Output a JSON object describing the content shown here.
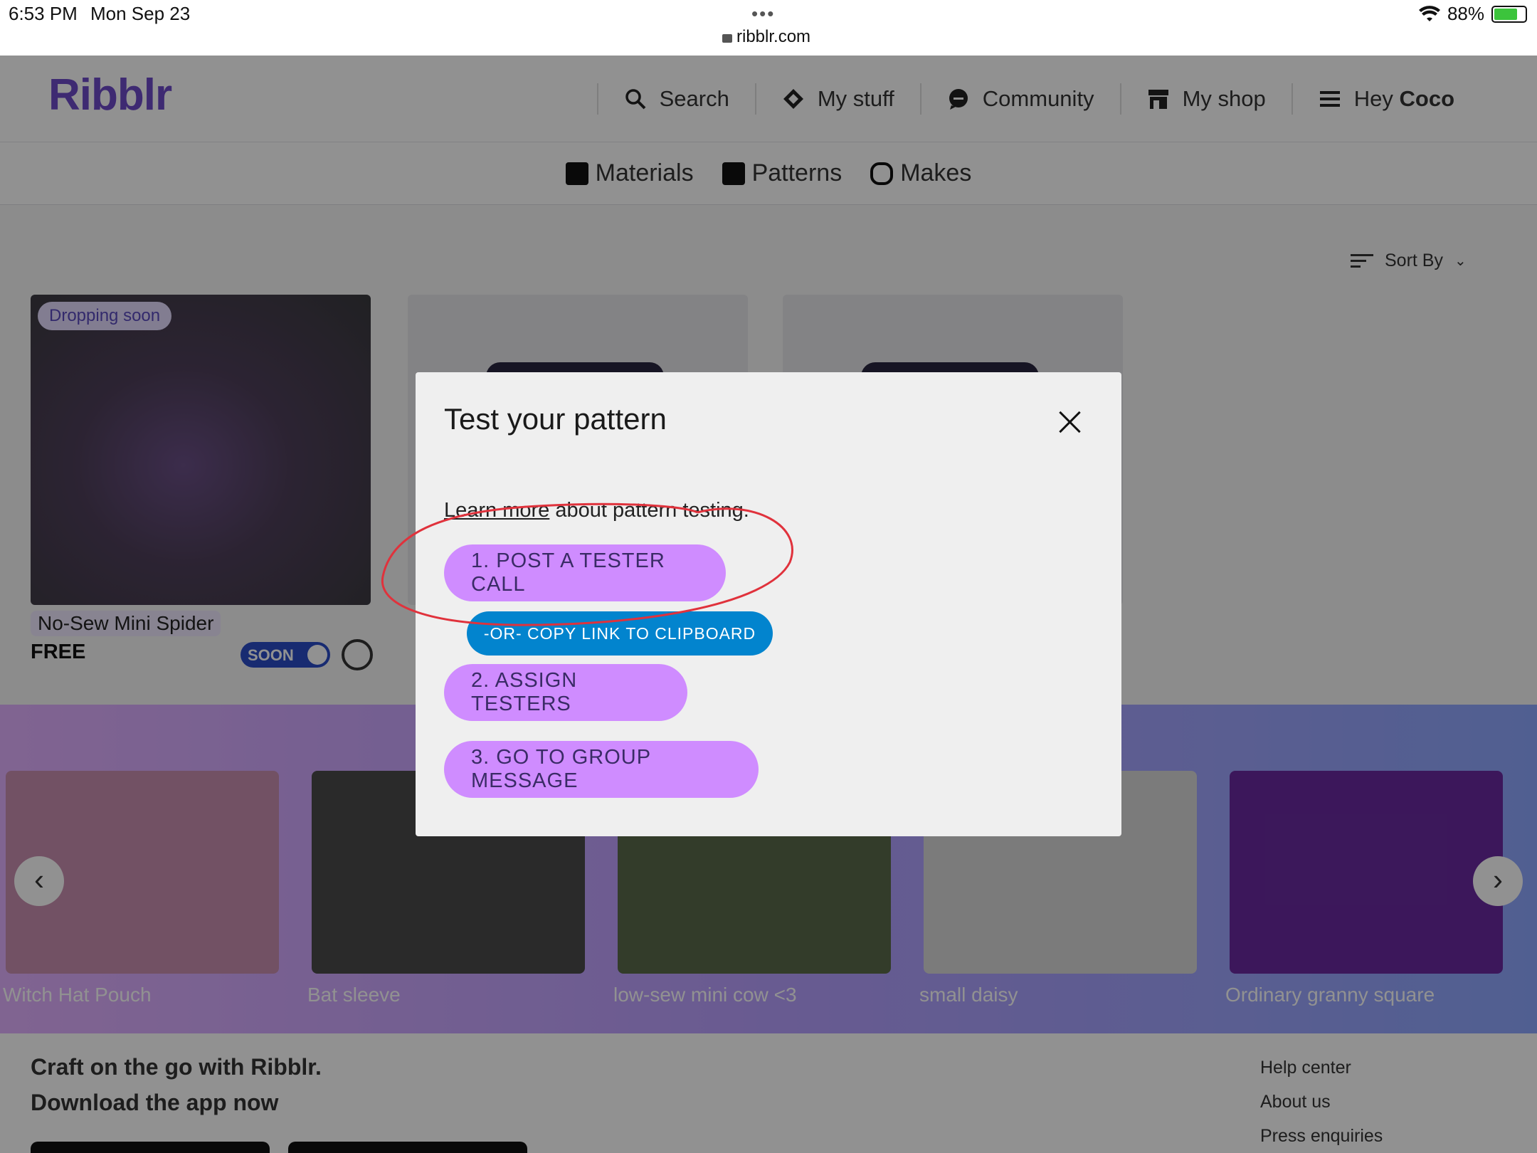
{
  "status": {
    "time": "6:53 PM",
    "date": "Mon Sep 23",
    "dots": "•••",
    "url": "ribblr.com",
    "battery": "88%"
  },
  "header": {
    "logo": "Ribblr",
    "nav": [
      {
        "label": "Search",
        "icon": "search-icon"
      },
      {
        "label": "My stuff",
        "icon": "diamond-icon"
      },
      {
        "label": "Community",
        "icon": "chat-icon"
      },
      {
        "label": "My shop",
        "icon": "shop-icon"
      }
    ],
    "greeting_prefix": "Hey",
    "greeting_name": "Coco"
  },
  "subnav": [
    {
      "label": "Materials",
      "icon": "bag-icon"
    },
    {
      "label": "Patterns",
      "icon": "book-icon"
    },
    {
      "label": "Makes",
      "icon": "yarn-icon"
    }
  ],
  "sort": {
    "label": "Sort By"
  },
  "card": {
    "badge": "Dropping soon",
    "title": "No-Sew Mini Spider",
    "price": "FREE",
    "toggle": "SOON"
  },
  "carousel": [
    "Witch Hat Pouch",
    "Bat sleeve",
    "low-sew mini cow <3",
    "small daisy",
    "Ordinary granny square"
  ],
  "footer": {
    "line1": "Craft on the go with Ribblr.",
    "line2": "Download the app now",
    "links": [
      "Help center",
      "About us",
      "Press enquiries"
    ]
  },
  "modal": {
    "title": "Test your pattern",
    "learn_more": "Learn more",
    "learn_rest": " about pattern testing.",
    "btn1": "1. POST A TESTER CALL",
    "copy": "-OR- COPY LINK TO CLIPBOARD",
    "btn2": "2. ASSIGN TESTERS",
    "btn3": "3. GO TO GROUP MESSAGE"
  },
  "colors": {
    "accent": "#cf8cff",
    "copy_button": "#0284ce",
    "annotation": "#e0323c"
  }
}
